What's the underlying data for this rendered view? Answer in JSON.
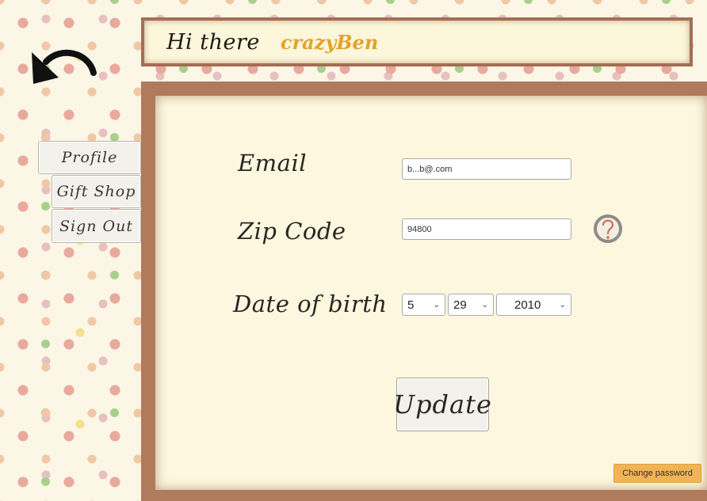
{
  "header": {
    "greeting": "Hi there",
    "username": "crazyBen"
  },
  "nav": {
    "back_icon": "back-arrow-icon",
    "items": [
      {
        "label": "Profile"
      },
      {
        "label": "Gift Shop"
      },
      {
        "label": "Sign Out"
      }
    ]
  },
  "form": {
    "email_label": "Email",
    "email_value": "b...b@.com",
    "zip_label": "Zip Code",
    "zip_value": "94800",
    "zip_help_icon": "question-help-icon",
    "dob_label": "Date of birth",
    "dob_month": "5",
    "dob_day": "29",
    "dob_year": "2010",
    "update_label": "Update",
    "change_password_label": "Change password"
  },
  "colors": {
    "frame_brown": "#b07a5d",
    "panel_cream": "#fcf7de",
    "username_orange": "#e3a22d",
    "change_password_orange": "#f0b455"
  }
}
